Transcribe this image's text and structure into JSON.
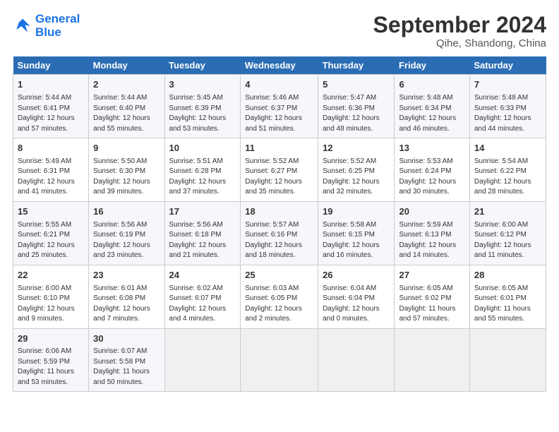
{
  "logo": {
    "line1": "General",
    "line2": "Blue"
  },
  "title": "September 2024",
  "location": "Qihe, Shandong, China",
  "days_of_week": [
    "Sunday",
    "Monday",
    "Tuesday",
    "Wednesday",
    "Thursday",
    "Friday",
    "Saturday"
  ],
  "weeks": [
    [
      {
        "day": "1",
        "info": "Sunrise: 5:44 AM\nSunset: 6:41 PM\nDaylight: 12 hours\nand 57 minutes."
      },
      {
        "day": "2",
        "info": "Sunrise: 5:44 AM\nSunset: 6:40 PM\nDaylight: 12 hours\nand 55 minutes."
      },
      {
        "day": "3",
        "info": "Sunrise: 5:45 AM\nSunset: 6:39 PM\nDaylight: 12 hours\nand 53 minutes."
      },
      {
        "day": "4",
        "info": "Sunrise: 5:46 AM\nSunset: 6:37 PM\nDaylight: 12 hours\nand 51 minutes."
      },
      {
        "day": "5",
        "info": "Sunrise: 5:47 AM\nSunset: 6:36 PM\nDaylight: 12 hours\nand 48 minutes."
      },
      {
        "day": "6",
        "info": "Sunrise: 5:48 AM\nSunset: 6:34 PM\nDaylight: 12 hours\nand 46 minutes."
      },
      {
        "day": "7",
        "info": "Sunrise: 5:48 AM\nSunset: 6:33 PM\nDaylight: 12 hours\nand 44 minutes."
      }
    ],
    [
      {
        "day": "8",
        "info": "Sunrise: 5:49 AM\nSunset: 6:31 PM\nDaylight: 12 hours\nand 41 minutes."
      },
      {
        "day": "9",
        "info": "Sunrise: 5:50 AM\nSunset: 6:30 PM\nDaylight: 12 hours\nand 39 minutes."
      },
      {
        "day": "10",
        "info": "Sunrise: 5:51 AM\nSunset: 6:28 PM\nDaylight: 12 hours\nand 37 minutes."
      },
      {
        "day": "11",
        "info": "Sunrise: 5:52 AM\nSunset: 6:27 PM\nDaylight: 12 hours\nand 35 minutes."
      },
      {
        "day": "12",
        "info": "Sunrise: 5:52 AM\nSunset: 6:25 PM\nDaylight: 12 hours\nand 32 minutes."
      },
      {
        "day": "13",
        "info": "Sunrise: 5:53 AM\nSunset: 6:24 PM\nDaylight: 12 hours\nand 30 minutes."
      },
      {
        "day": "14",
        "info": "Sunrise: 5:54 AM\nSunset: 6:22 PM\nDaylight: 12 hours\nand 28 minutes."
      }
    ],
    [
      {
        "day": "15",
        "info": "Sunrise: 5:55 AM\nSunset: 6:21 PM\nDaylight: 12 hours\nand 25 minutes."
      },
      {
        "day": "16",
        "info": "Sunrise: 5:56 AM\nSunset: 6:19 PM\nDaylight: 12 hours\nand 23 minutes."
      },
      {
        "day": "17",
        "info": "Sunrise: 5:56 AM\nSunset: 6:18 PM\nDaylight: 12 hours\nand 21 minutes."
      },
      {
        "day": "18",
        "info": "Sunrise: 5:57 AM\nSunset: 6:16 PM\nDaylight: 12 hours\nand 18 minutes."
      },
      {
        "day": "19",
        "info": "Sunrise: 5:58 AM\nSunset: 6:15 PM\nDaylight: 12 hours\nand 16 minutes."
      },
      {
        "day": "20",
        "info": "Sunrise: 5:59 AM\nSunset: 6:13 PM\nDaylight: 12 hours\nand 14 minutes."
      },
      {
        "day": "21",
        "info": "Sunrise: 6:00 AM\nSunset: 6:12 PM\nDaylight: 12 hours\nand 11 minutes."
      }
    ],
    [
      {
        "day": "22",
        "info": "Sunrise: 6:00 AM\nSunset: 6:10 PM\nDaylight: 12 hours\nand 9 minutes."
      },
      {
        "day": "23",
        "info": "Sunrise: 6:01 AM\nSunset: 6:08 PM\nDaylight: 12 hours\nand 7 minutes."
      },
      {
        "day": "24",
        "info": "Sunrise: 6:02 AM\nSunset: 6:07 PM\nDaylight: 12 hours\nand 4 minutes."
      },
      {
        "day": "25",
        "info": "Sunrise: 6:03 AM\nSunset: 6:05 PM\nDaylight: 12 hours\nand 2 minutes."
      },
      {
        "day": "26",
        "info": "Sunrise: 6:04 AM\nSunset: 6:04 PM\nDaylight: 12 hours\nand 0 minutes."
      },
      {
        "day": "27",
        "info": "Sunrise: 6:05 AM\nSunset: 6:02 PM\nDaylight: 11 hours\nand 57 minutes."
      },
      {
        "day": "28",
        "info": "Sunrise: 6:05 AM\nSunset: 6:01 PM\nDaylight: 11 hours\nand 55 minutes."
      }
    ],
    [
      {
        "day": "29",
        "info": "Sunrise: 6:06 AM\nSunset: 5:59 PM\nDaylight: 11 hours\nand 53 minutes."
      },
      {
        "day": "30",
        "info": "Sunrise: 6:07 AM\nSunset: 5:58 PM\nDaylight: 11 hours\nand 50 minutes."
      },
      null,
      null,
      null,
      null,
      null
    ]
  ]
}
